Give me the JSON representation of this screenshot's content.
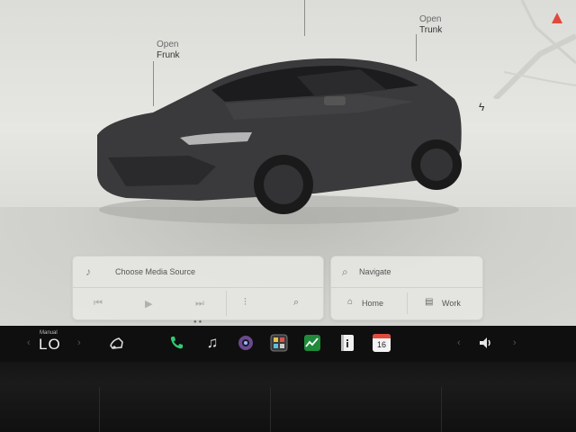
{
  "car_view": {
    "frunk": {
      "line1": "Open",
      "line2": "Frunk"
    },
    "trunk": {
      "line1": "Open",
      "line2": "Trunk"
    },
    "charge_port_icon": "lightning-icon",
    "nav_arrow_color": "#e0493c"
  },
  "media": {
    "source_placeholder": "Choose Media Source",
    "icons": [
      "music-note-icon",
      "skip-back-icon",
      "play-icon",
      "skip-forward-icon",
      "equalizer-icon",
      "search-icon"
    ]
  },
  "navigation": {
    "search_placeholder": "Navigate",
    "home_label": "Home",
    "work_label": "Work"
  },
  "taskbar": {
    "climate_mode": "Manual",
    "temperature": "LO",
    "calendar_day": "16",
    "apps": [
      "car-icon",
      "phone-icon",
      "music-icon",
      "camera-icon",
      "app-launcher-icon",
      "stocks-icon",
      "notes-icon",
      "calendar-icon",
      "volume-icon"
    ],
    "phone_color": "#2ecc71"
  }
}
